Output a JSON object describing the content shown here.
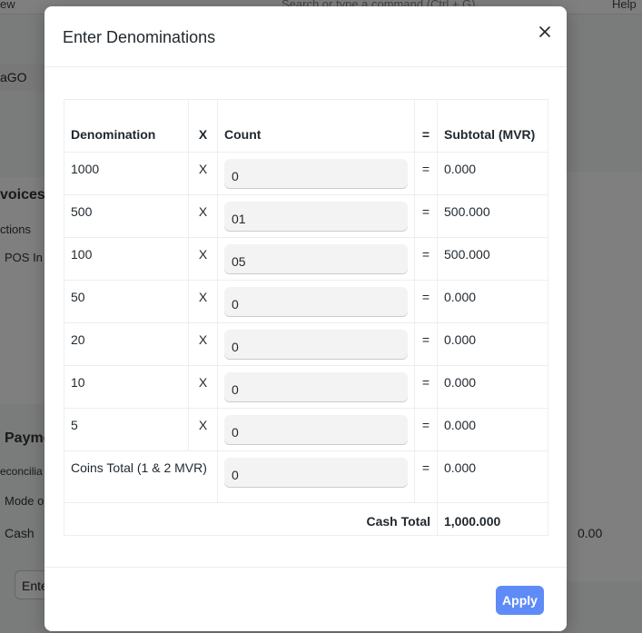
{
  "background": {
    "topbar_left": "ew",
    "search_placeholder": "Search or type a command (Ctrl + G)",
    "help": "Help",
    "field_value": "aGO",
    "section_title": "voices",
    "section_sub": "ctions",
    "row_text": "POS In",
    "payment_title": "Payme",
    "reconcile_text": "econcilia",
    "mode_text": "Mode o",
    "cash_label": "Cash",
    "cash_amount": "0.00",
    "enter_button": "Ente"
  },
  "modal": {
    "title": "Enter Denominations",
    "close_icon": "close-icon",
    "columns": {
      "denomination": "Denomination",
      "x": "X",
      "count": "Count",
      "equals": "=",
      "subtotal": "Subtotal (MVR)"
    },
    "rows": [
      {
        "denomination": "1000",
        "x": "X",
        "count": "0",
        "equals": "=",
        "subtotal": "0.000"
      },
      {
        "denomination": "500",
        "x": "X",
        "count": "01",
        "equals": "=",
        "subtotal": "500.000"
      },
      {
        "denomination": "100",
        "x": "X",
        "count": "05",
        "equals": "=",
        "subtotal": "500.000"
      },
      {
        "denomination": "50",
        "x": "X",
        "count": "0",
        "equals": "=",
        "subtotal": "0.000"
      },
      {
        "denomination": "20",
        "x": "X",
        "count": "0",
        "equals": "=",
        "subtotal": "0.000"
      },
      {
        "denomination": "10",
        "x": "X",
        "count": "0",
        "equals": "=",
        "subtotal": "0.000"
      },
      {
        "denomination": "5",
        "x": "X",
        "count": "0",
        "equals": "=",
        "subtotal": "0.000"
      }
    ],
    "coins": {
      "label": "Coins Total (1 & 2 MVR)",
      "count": "0",
      "equals": "=",
      "subtotal": "0.000"
    },
    "total": {
      "label": "Cash Total",
      "value": "1,000.000"
    },
    "apply_label": "Apply",
    "colors": {
      "primary": "#5e8bf7",
      "input_bg": "#f3f3f3",
      "border": "#ebeef0"
    }
  }
}
